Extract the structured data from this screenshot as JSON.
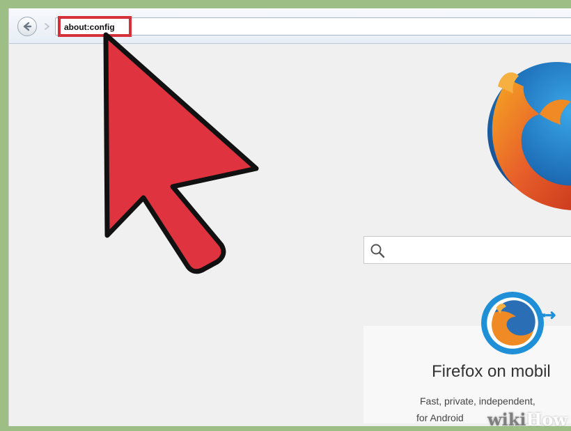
{
  "browser": {
    "url": "about:config",
    "back_icon": "back-arrow-icon",
    "forward_icon": "forward-arrow-icon"
  },
  "newtab": {
    "logo": "firefox-logo",
    "search_icon": "search-icon",
    "search_placeholder": ""
  },
  "promo": {
    "title": "Firefox on mobil",
    "line1": "Fast, private, independent,",
    "line2": "for Android"
  },
  "overlay": {
    "cursor": "red-arrow-cursor-icon",
    "highlight_color": "#d6313a"
  },
  "watermark": {
    "part1": "wiki",
    "part2": "How"
  },
  "colors": {
    "border_green": "#9dbf85",
    "cursor_red": "#e03340",
    "firefox_blue": "#1f8fd8",
    "firefox_orange": "#f08a24"
  }
}
